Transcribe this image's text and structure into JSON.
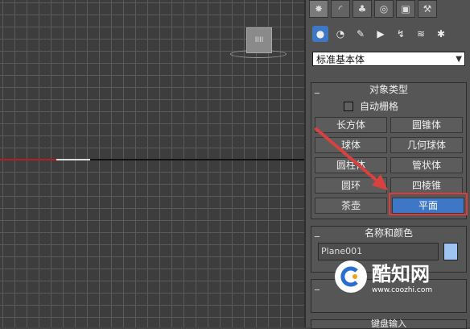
{
  "viewport": {
    "cube_label": "IIII"
  },
  "panel": {
    "tabs": [
      {
        "icon": "create-icon",
        "glyph": "✸"
      },
      {
        "icon": "modify-icon",
        "glyph": "◜"
      },
      {
        "icon": "hierarchy-icon",
        "glyph": "♣"
      },
      {
        "icon": "motion-icon",
        "glyph": "◎"
      },
      {
        "icon": "display-icon",
        "glyph": "▣"
      },
      {
        "icon": "utilities-icon",
        "glyph": "⚒"
      }
    ],
    "subtabs": [
      {
        "icon": "geometry-icon",
        "glyph": "●"
      },
      {
        "icon": "shapes-icon",
        "glyph": "◔"
      },
      {
        "icon": "lights-icon",
        "glyph": "✎"
      },
      {
        "icon": "cameras-icon",
        "glyph": "▶"
      },
      {
        "icon": "helpers-icon",
        "glyph": "↯"
      },
      {
        "icon": "spacewarps-icon",
        "glyph": "≋"
      },
      {
        "icon": "systems-icon",
        "glyph": "✱"
      }
    ],
    "dropdown": {
      "value": "标准基本体"
    },
    "object_type": {
      "title": "对象类型",
      "autogrid": "自动栅格",
      "buttons": [
        "长方体",
        "圆锥体",
        "球体",
        "几何球体",
        "圆柱体",
        "管状体",
        "圆环",
        "四棱锥",
        "茶壶",
        "平面"
      ]
    },
    "name_color": {
      "title": "名称和颜色",
      "name": "Plane001",
      "color": "#9fc4f2"
    },
    "next_title": "键盘输入"
  },
  "watermark": {
    "text": "酷知网",
    "url": "www.coozhi.com"
  }
}
